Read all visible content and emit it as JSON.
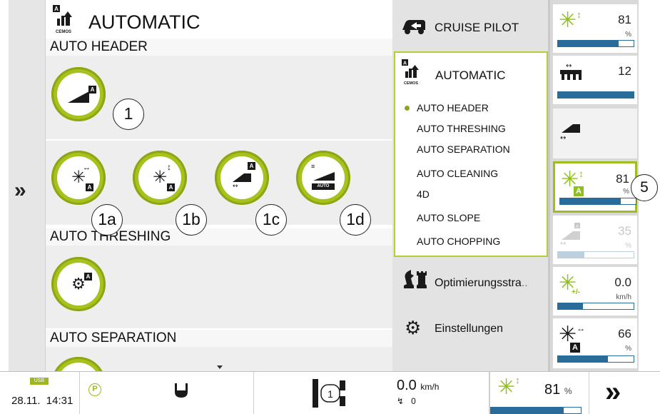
{
  "main": {
    "title": "AUTOMATIC",
    "title_badge": "A",
    "title_sub": "CEMOS",
    "sections": {
      "auto_header": "AUTO HEADER",
      "auto_threshing": "AUTO THRESHING",
      "auto_separation": "AUTO SEPARATION"
    },
    "buttons": {
      "b1_badge": "A",
      "b1a_badge": "A",
      "b1b_badge": "A",
      "b1c_badge": "A",
      "b1d_label": "AUTO",
      "thresh_badge": "A"
    },
    "callouts": [
      "1",
      "1a",
      "1b",
      "1c",
      "1d",
      "5"
    ]
  },
  "menu": {
    "cruise_pilot": "CRUISE PILOT",
    "automatic": "AUTOMATIC",
    "automatic_badge": "A",
    "automatic_sub": "CEMOS",
    "sub_items": [
      "AUTO HEADER",
      "AUTO THRESHING",
      "AUTO SEPARATION",
      "AUTO CLEANING",
      "4D",
      "AUTO SLOPE",
      "AUTO CHOPPING"
    ],
    "optimization": "Optimierungsstra",
    "optimization_ellipsis": "..",
    "settings": "Einstellungen"
  },
  "tiles": [
    {
      "value": "81",
      "unit": "%",
      "fill": 0.8
    },
    {
      "value": "12",
      "unit": "",
      "fill": 1.0
    },
    {
      "value": "",
      "unit": "",
      "fill": 0
    },
    {
      "value": "81",
      "unit": "%",
      "fill": 0.8,
      "badge": "A"
    },
    {
      "value": "35",
      "unit": "%",
      "fill": 0.35,
      "badge": "A"
    },
    {
      "value": "0.0",
      "unit": "km/h",
      "fill": 0.33,
      "sub": "+/-"
    },
    {
      "value": "66",
      "unit": "%",
      "fill": 0.66,
      "badge": "A"
    }
  ],
  "bottom": {
    "usb": "USB",
    "date": "28.11.",
    "time": "14:31",
    "parking": "P",
    "gear_display": "1",
    "speed_value": "0.0",
    "speed_unit": "km/h",
    "gear_value": "0",
    "rotor_value": "81",
    "rotor_unit": "%",
    "rotor_fill": 0.81
  },
  "colors": {
    "accent_green": "#a6c21c",
    "bar_blue": "#2a6c99"
  }
}
